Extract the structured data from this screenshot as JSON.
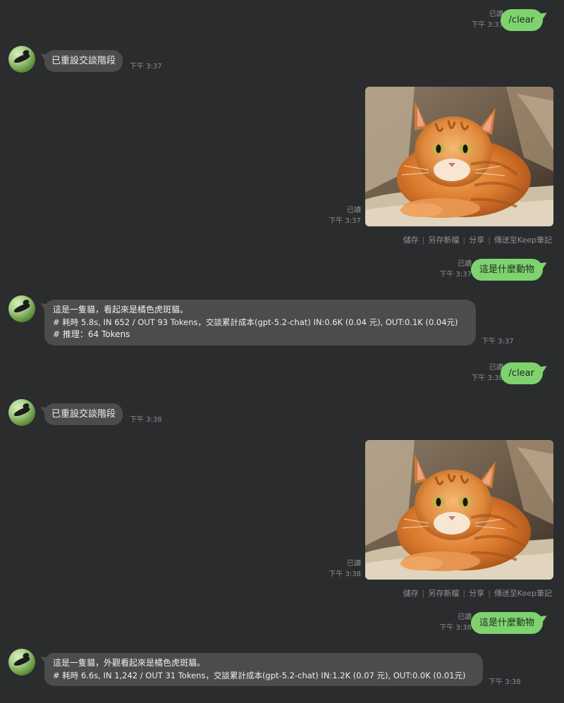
{
  "messages": [
    {
      "type": "out",
      "text": "/clear",
      "read": "已讀",
      "time": "下午 3:37"
    },
    {
      "type": "in",
      "lines": [
        "已重設交談階段"
      ],
      "time": "下午 3:37"
    },
    {
      "type": "image",
      "read": "已讀",
      "time": "下午 3:37",
      "actions": [
        "儲存",
        "另存新檔",
        "分享",
        "傳送至Keep筆記"
      ]
    },
    {
      "type": "out",
      "text": "這是什麼動物",
      "read": "已讀",
      "time": "下午 3:37"
    },
    {
      "type": "in",
      "lines": [
        "這是一隻貓，看起來是橘色虎斑貓。",
        "# 耗時 5.8s, IN 652 / OUT 93 Tokens，交談累計成本(gpt-5.2-chat) IN:0.6K (0.04 元), OUT:0.1K (0.04元)",
        "# 推理：64 Tokens"
      ],
      "time": "下午 3:37"
    },
    {
      "type": "out",
      "text": "/clear",
      "read": "已讀",
      "time": "下午 3:38"
    },
    {
      "type": "in",
      "lines": [
        "已重設交談階段"
      ],
      "time": "下午 3:38"
    },
    {
      "type": "image",
      "read": "已讀",
      "time": "下午 3:38",
      "actions": [
        "儲存",
        "另存新檔",
        "分享",
        "傳送至Keep筆記"
      ]
    },
    {
      "type": "out",
      "text": "這是什麼動物",
      "read": "已讀",
      "time": "下午 3:38"
    },
    {
      "type": "in",
      "lines": [
        "這是一隻貓，外觀看起來是橘色虎斑貓。",
        "# 耗時 6.6s, IN 1,242 / OUT 31 Tokens，交談累計成本(gpt-5.2-chat) IN:1.2K (0.07 元), OUT:0.0K (0.01元)"
      ],
      "time": "下午 3:38"
    }
  ],
  "colors": {
    "background": "#2b2c2e",
    "outgoing_bubble": "#7ed36f",
    "incoming_bubble": "#4b4c4e",
    "meta_text": "#8b8d90"
  },
  "icons": {
    "avatar": "bird-on-branch-avatar",
    "photo": "orange-tabby-cat-photo"
  }
}
